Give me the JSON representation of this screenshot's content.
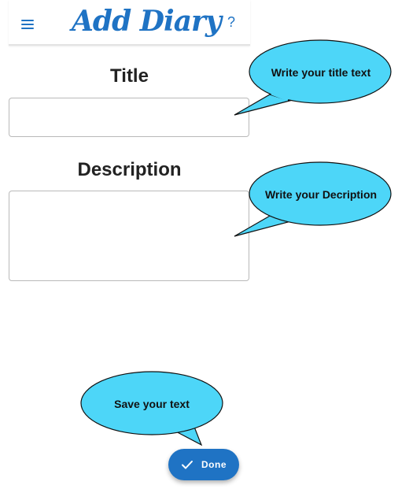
{
  "header": {
    "app_title": "Add Diary",
    "menu_icon": "hamburger-menu-icon",
    "help_label": "?"
  },
  "form": {
    "title_label": "Title",
    "title_value": "",
    "description_label": "Description",
    "description_value": ""
  },
  "callouts": {
    "title_hint": "Write your title text",
    "description_hint": "Write your Decription",
    "save_hint": "Save your text"
  },
  "actions": {
    "done_label": "Done",
    "done_icon": "check-icon"
  },
  "colors": {
    "accent": "#1f73c4",
    "callout_fill": "#4dd6f8",
    "callout_stroke": "#111111"
  }
}
